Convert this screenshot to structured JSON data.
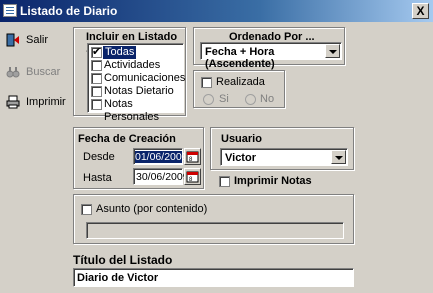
{
  "window": {
    "title": "Listado de Diario",
    "close_label": "X"
  },
  "toolbar": [
    {
      "label": "Salir",
      "icon": "exit-icon",
      "enabled": true
    },
    {
      "label": "Buscar",
      "icon": "binoculars-icon",
      "enabled": false
    },
    {
      "label": "Imprimir",
      "icon": "printer-icon",
      "enabled": true
    }
  ],
  "include": {
    "label": "Incluir en Listado ...",
    "items": [
      {
        "label": "Todas",
        "checked": true,
        "selected": true
      },
      {
        "label": "Actividades",
        "checked": false
      },
      {
        "label": "Comunicaciones",
        "checked": false
      },
      {
        "label": "Notas Dietario",
        "checked": false
      },
      {
        "label": "Notas Personales",
        "checked": false
      }
    ]
  },
  "order": {
    "label": "Ordenado Por ...",
    "value": "Fecha + Hora (Ascendente)"
  },
  "realizada": {
    "label": "Realizada",
    "checked": false,
    "yes_label": "Si",
    "no_label": "No"
  },
  "dates": {
    "label": "Fecha de Creación",
    "from_label": "Desde",
    "from_value": "01/06/2009",
    "to_label": "Hasta",
    "to_value": "30/06/2009"
  },
  "user": {
    "label": "Usuario",
    "value": "Victor"
  },
  "print_notes": {
    "label": "Imprimir Notas",
    "checked": false
  },
  "subject": {
    "label": "Asunto (por contenido)",
    "checked": false,
    "value": ""
  },
  "listing_title": {
    "label": "Título del Listado",
    "value": "Diario de Victor"
  },
  "colors": {
    "title_bar": "#0a246a",
    "face": "#d4d0c8",
    "selection": "#0a246a"
  }
}
